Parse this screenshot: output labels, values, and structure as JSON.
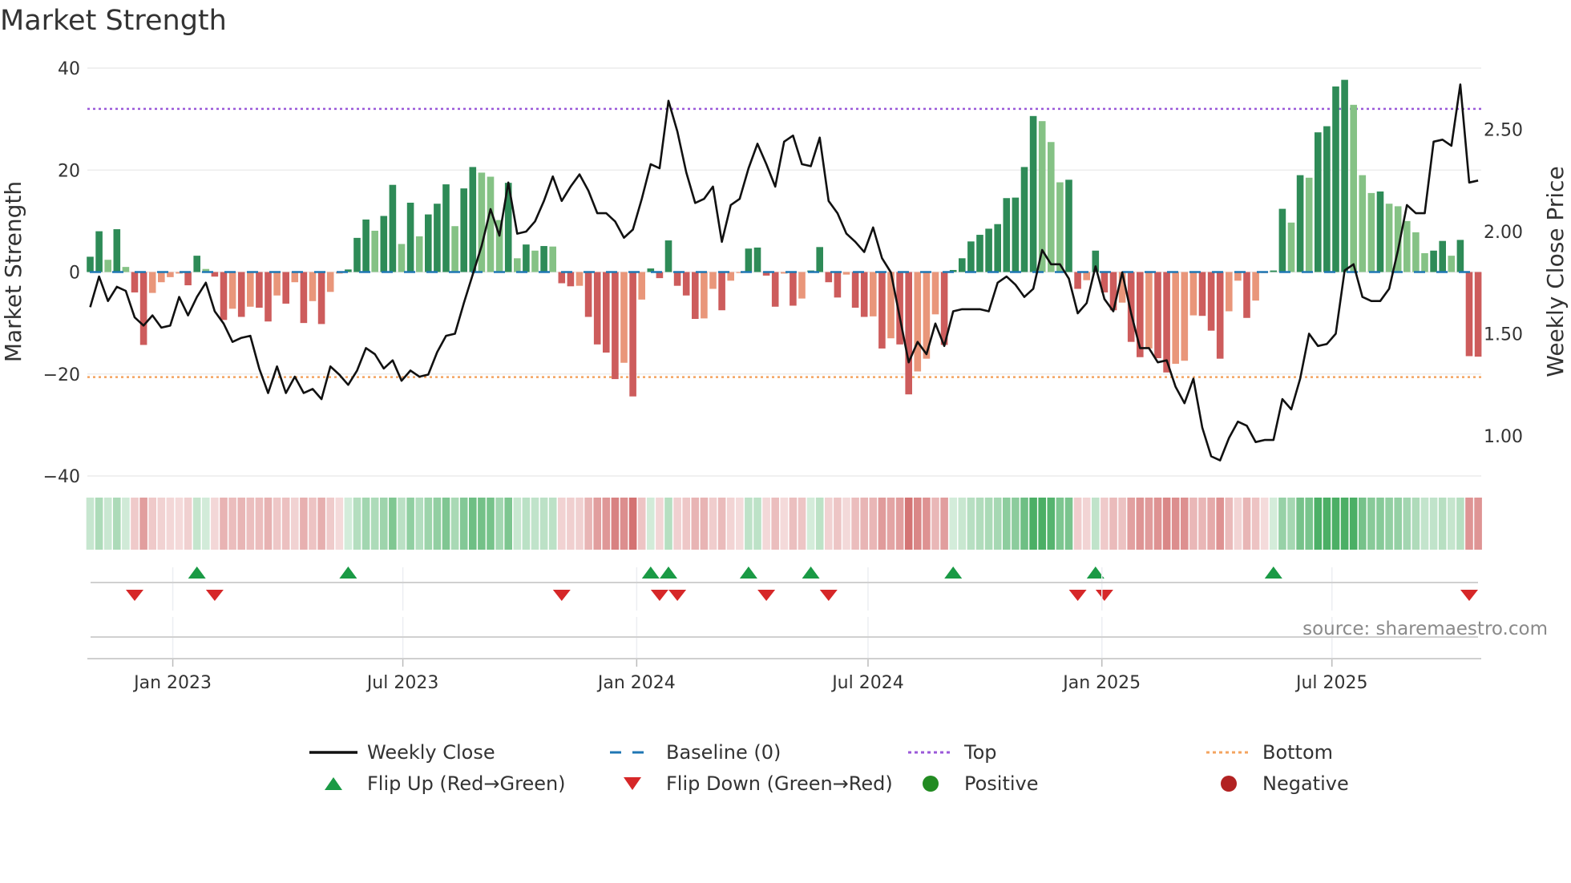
{
  "title": "Market Strength",
  "source": "source: sharemaestro.com",
  "colors": {
    "dark_green": "#2e8b57",
    "light_green": "#85c285",
    "dark_red": "#cd5c5c",
    "light_red": "#e9967a",
    "price": "#111111",
    "baseline": "#1f77b4",
    "top": "#9b59d9",
    "bottom": "#f4a460",
    "flip_up": "#1a9a45",
    "flip_down": "#d62728",
    "positive": "#228b22",
    "negative": "#b22222"
  },
  "chart_data": {
    "type": "bar",
    "title": "Market Strength",
    "ylabel": "Market Strength",
    "y2label": "Weekly Close Price",
    "ylim": [
      -40,
      40
    ],
    "y2lim": [
      0.804,
      2.8
    ],
    "yticks": [
      "40",
      "20",
      "0",
      "−20",
      "−40"
    ],
    "ytick_values": [
      40,
      20,
      0,
      -20,
      -40
    ],
    "y2ticks": [
      "2.50",
      "2.00",
      "1.50",
      "1.00"
    ],
    "y2tick_values": [
      2.5,
      2.0,
      1.5,
      1.0
    ],
    "start_week": "2022-10-28",
    "frequency": "weekly",
    "xticks": [
      {
        "label": "Jan 2023",
        "date": "2023-01-01"
      },
      {
        "label": "Jul 2023",
        "date": "2023-07-01"
      },
      {
        "label": "Jan 2024",
        "date": "2024-01-01"
      },
      {
        "label": "Jul 2024",
        "date": "2024-07-01"
      },
      {
        "label": "Jan 2025",
        "date": "2025-01-01"
      },
      {
        "label": "Jul 2025",
        "date": "2025-07-01"
      }
    ],
    "top_level": 32,
    "bottom_level": -20.6,
    "baseline": 0,
    "strength": [
      3,
      8,
      2.4,
      8.4,
      1,
      -4,
      -14.3,
      -4.1,
      -2,
      -1,
      -0.3,
      -2.6,
      3.2,
      0.6,
      -0.9,
      -9.4,
      -7.2,
      -8.8,
      -6.8,
      -7,
      -9.7,
      -4.6,
      -6.2,
      -2,
      -10,
      -5.7,
      -10.2,
      -3.9,
      -0.3,
      0.5,
      6.7,
      10.3,
      8.1,
      11,
      17.1,
      5.5,
      13.6,
      7,
      11.3,
      13.4,
      17.2,
      9,
      16.4,
      20.6,
      19.5,
      18.7,
      10.2,
      17.5,
      2.7,
      5.4,
      4.2,
      5.1,
      5.0,
      -2.2,
      -2.8,
      -2.7,
      -8.8,
      -14.2,
      -15.8,
      -21,
      -17.8,
      -24.4,
      -5.4,
      0.7,
      -1.2,
      6.2,
      -2.7,
      -4.6,
      -9.2,
      -9.1,
      -3.3,
      -7.5,
      -1.7,
      -0.2,
      4.6,
      4.8,
      -0.7,
      -6.8,
      -0.3,
      -6.6,
      -5.2,
      0.3,
      4.9,
      -2,
      -5,
      -0.5,
      -7,
      -8.8,
      -8.7,
      -15,
      -13,
      -14.2,
      -24,
      -19.5,
      -17,
      -8.3,
      -14.3,
      0.4,
      2.7,
      6,
      7.3,
      8.5,
      9.4,
      14.5,
      14.6,
      20.6,
      30.6,
      29.6,
      25.5,
      17.6,
      18.1,
      -3.3,
      -1.6,
      4.2,
      -4,
      -7.5,
      -6,
      -13.7,
      -16.7,
      -15,
      -16.9,
      -19.7,
      -18,
      -17.4,
      -8.5,
      -8.6,
      -11.5,
      -17,
      -7.7,
      -1.7,
      -9,
      -5.6,
      -0.2,
      0.3,
      12.4,
      9.7,
      19,
      18.5,
      27.4,
      28.6,
      36.4,
      37.7,
      32.8,
      19,
      15.5,
      15.8,
      13.4,
      12.9,
      10,
      7.8,
      3.7,
      4.2,
      6.1,
      3.2,
      6.3,
      -16.5,
      -16.6
    ],
    "weekly_close": [
      1.63,
      1.78,
      1.66,
      1.73,
      1.71,
      1.58,
      1.54,
      1.59,
      1.53,
      1.54,
      1.68,
      1.59,
      1.68,
      1.75,
      1.61,
      1.55,
      1.46,
      1.48,
      1.49,
      1.33,
      1.21,
      1.34,
      1.21,
      1.29,
      1.21,
      1.23,
      1.18,
      1.34,
      1.3,
      1.25,
      1.32,
      1.43,
      1.4,
      1.33,
      1.37,
      1.27,
      1.32,
      1.29,
      1.3,
      1.41,
      1.49,
      1.5,
      1.65,
      1.79,
      1.93,
      2.11,
      1.98,
      2.24,
      1.99,
      2.0,
      2.05,
      2.15,
      2.27,
      2.15,
      2.22,
      2.28,
      2.2,
      2.09,
      2.09,
      2.05,
      1.97,
      2.01,
      2.16,
      2.33,
      2.31,
      2.64,
      2.49,
      2.29,
      2.14,
      2.16,
      2.22,
      1.95,
      2.13,
      2.16,
      2.31,
      2.43,
      2.33,
      2.22,
      2.44,
      2.47,
      2.33,
      2.32,
      2.46,
      2.15,
      2.09,
      1.99,
      1.95,
      1.9,
      2.02,
      1.87,
      1.8,
      1.58,
      1.36,
      1.46,
      1.4,
      1.55,
      1.44,
      1.61,
      1.62,
      1.62,
      1.62,
      1.61,
      1.75,
      1.78,
      1.74,
      1.68,
      1.72,
      1.91,
      1.84,
      1.84,
      1.77,
      1.6,
      1.65,
      1.83,
      1.67,
      1.61,
      1.8,
      1.6,
      1.43,
      1.43,
      1.36,
      1.37,
      1.24,
      1.16,
      1.28,
      1.04,
      0.9,
      0.88,
      0.99,
      1.07,
      1.05,
      0.97,
      0.98,
      0.98,
      1.18,
      1.13,
      1.28,
      1.5,
      1.44,
      1.45,
      1.5,
      1.81,
      1.84,
      1.68,
      1.66,
      1.66,
      1.72,
      1.91,
      2.13,
      2.09,
      2.09,
      2.44,
      2.45,
      2.42,
      2.72,
      2.24,
      2.25
    ],
    "flip_up_weeks": [
      12,
      29,
      63,
      65,
      74,
      81,
      97,
      113,
      133
    ],
    "flip_down_weeks": [
      5,
      14,
      53,
      64,
      66,
      76,
      83,
      111,
      114,
      155
    ]
  },
  "legend": [
    {
      "label": "Weekly Close",
      "symbol": "solid-line"
    },
    {
      "label": "Baseline (0)",
      "symbol": "dashed-line"
    },
    {
      "label": "Top",
      "symbol": "dotted-line-top"
    },
    {
      "label": "Bottom",
      "symbol": "dotted-line-bottom"
    },
    {
      "label": "Flip Up (Red→Green)",
      "symbol": "triangle-up"
    },
    {
      "label": "Flip Down (Green→Red)",
      "symbol": "triangle-down"
    },
    {
      "label": "Positive",
      "symbol": "circle-green"
    },
    {
      "label": "Negative",
      "symbol": "circle-red"
    }
  ]
}
